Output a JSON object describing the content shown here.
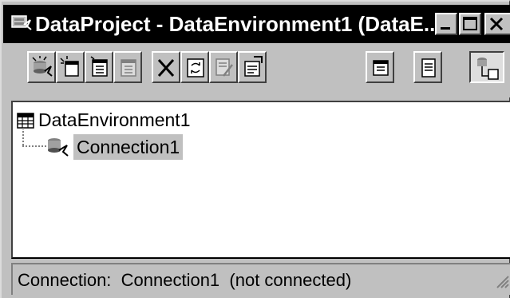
{
  "window": {
    "title": "DataProject - DataEnvironment1 (DataE...",
    "icon": "data-environment-app-icon"
  },
  "caption_buttons": [
    "minimize-icon",
    "maximize-icon",
    "close-icon"
  ],
  "toolbar": {
    "buttons": [
      {
        "name": "add-connection-button",
        "icon": "add-connection-icon"
      },
      {
        "name": "add-command-button",
        "icon": "add-command-icon"
      },
      {
        "name": "add-child-command-button",
        "icon": "add-child-command-icon"
      },
      {
        "name": "add-grouping-button",
        "icon": "add-grouping-icon"
      },
      {
        "name": "delete-button",
        "icon": "delete-x-icon"
      },
      {
        "name": "refresh-button",
        "icon": "refresh-icon"
      },
      {
        "name": "design-button",
        "icon": "design-icon"
      },
      {
        "name": "properties-button",
        "icon": "properties-icon"
      },
      {
        "name": "view-code-button",
        "icon": "view-code-icon"
      },
      {
        "name": "options-button",
        "icon": "options-icon"
      },
      {
        "name": "sort-by-connection-button",
        "icon": "sort-by-connection-icon"
      }
    ]
  },
  "tree": {
    "root": {
      "label": "DataEnvironment1",
      "icon": "data-environment-icon"
    },
    "children": [
      {
        "label": "Connection1",
        "icon": "connection-icon",
        "selected": true
      }
    ]
  },
  "status": {
    "text": "Connection:  Connection1  (not connected)"
  }
}
